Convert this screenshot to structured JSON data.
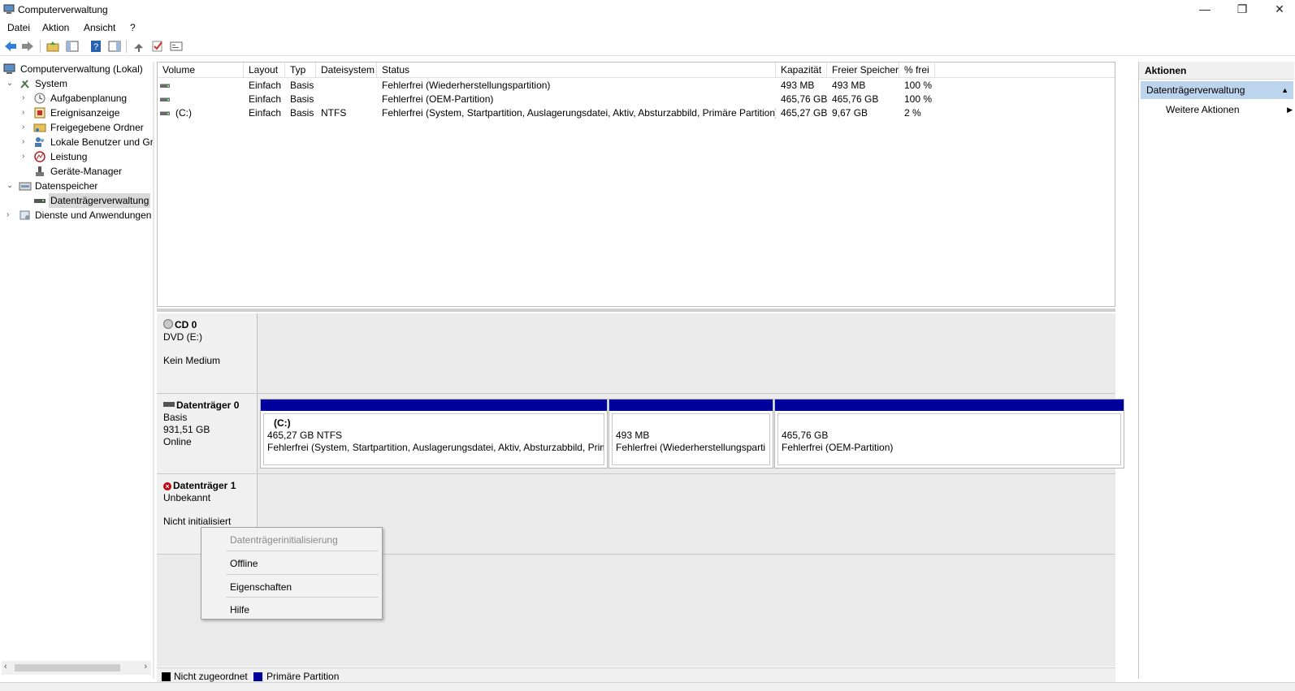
{
  "window": {
    "title": "Computerverwaltung",
    "controls": {
      "minimize": "—",
      "restore": "❐",
      "close": "✕"
    }
  },
  "menu": [
    "Datei",
    "Aktion",
    "Ansicht",
    "?"
  ],
  "toolbar": [
    "back-icon",
    "forward-icon",
    "up-folder-icon",
    "show-hide-tree-icon",
    "help-icon",
    "show-action-pane-icon",
    "connect-icon",
    "check-icon",
    "properties-icon"
  ],
  "tree": {
    "root": "Computerverwaltung (Lokal)",
    "system": "System",
    "aufgabenplanung": "Aufgabenplanung",
    "ereignisanzeige": "Ereignisanzeige",
    "freigegebene_ordner": "Freigegebene Ordner",
    "lokale_benutzer": "Lokale Benutzer und Gr",
    "leistung": "Leistung",
    "geraete_manager": "Geräte-Manager",
    "datenspeicher": "Datenspeicher",
    "datentraegerverwaltung": "Datenträgerverwaltung",
    "dienste": "Dienste und Anwendungen"
  },
  "volumes": {
    "columns": [
      "Volume",
      "Layout",
      "Typ",
      "Dateisystem",
      "Status",
      "Kapazität",
      "Freier Speicher",
      "% frei"
    ],
    "rows": [
      {
        "volume": "",
        "layout": "Einfach",
        "typ": "Basis",
        "fs": "",
        "status": "Fehlerfrei (Wiederherstellungspartition)",
        "kap": "493 MB",
        "frei": "493 MB",
        "pct": "100 %"
      },
      {
        "volume": "",
        "layout": "Einfach",
        "typ": "Basis",
        "fs": "",
        "status": "Fehlerfrei (OEM-Partition)",
        "kap": "465,76 GB",
        "frei": "465,76 GB",
        "pct": "100 %"
      },
      {
        "volume": "(C:)",
        "layout": "Einfach",
        "typ": "Basis",
        "fs": "NTFS",
        "status": "Fehlerfrei (System, Startpartition, Auslagerungsdatei, Aktiv, Absturzabbild, Primäre Partition)",
        "kap": "465,27 GB",
        "frei": "9,67 GB",
        "pct": "2 %"
      }
    ]
  },
  "disks": {
    "cd0": {
      "name": "CD 0",
      "line1": "DVD (E:)",
      "line2": "Kein Medium"
    },
    "disk0": {
      "name": "Datenträger 0",
      "line1": "Basis",
      "line2": "931,51 GB",
      "line3": "Online",
      "partitions": [
        {
          "title": "(C:)",
          "size": "465,27 GB NTFS",
          "status": "Fehlerfrei (System, Startpartition, Auslagerungsdatei, Aktiv, Absturzabbild, Prima"
        },
        {
          "title": "",
          "size": "493 MB",
          "status": "Fehlerfrei (Wiederherstellungsparti"
        },
        {
          "title": "",
          "size": "465,76 GB",
          "status": "Fehlerfrei (OEM-Partition)"
        }
      ]
    },
    "disk1": {
      "name": "Datenträger 1",
      "line1": "Unbekannt",
      "line2": "Nicht initialisiert"
    }
  },
  "legend": [
    {
      "label": "Nicht zugeordnet",
      "color": "#000000"
    },
    {
      "label": "Primäre Partition",
      "color": "#00009c"
    }
  ],
  "actions": {
    "header": "Aktionen",
    "section": "Datenträgerverwaltung",
    "sub": "Weitere Aktionen"
  },
  "context_menu": {
    "items": [
      "Datenträgerinitialisierung",
      "Offline",
      "Eigenschaften",
      "Hilfe"
    ]
  }
}
